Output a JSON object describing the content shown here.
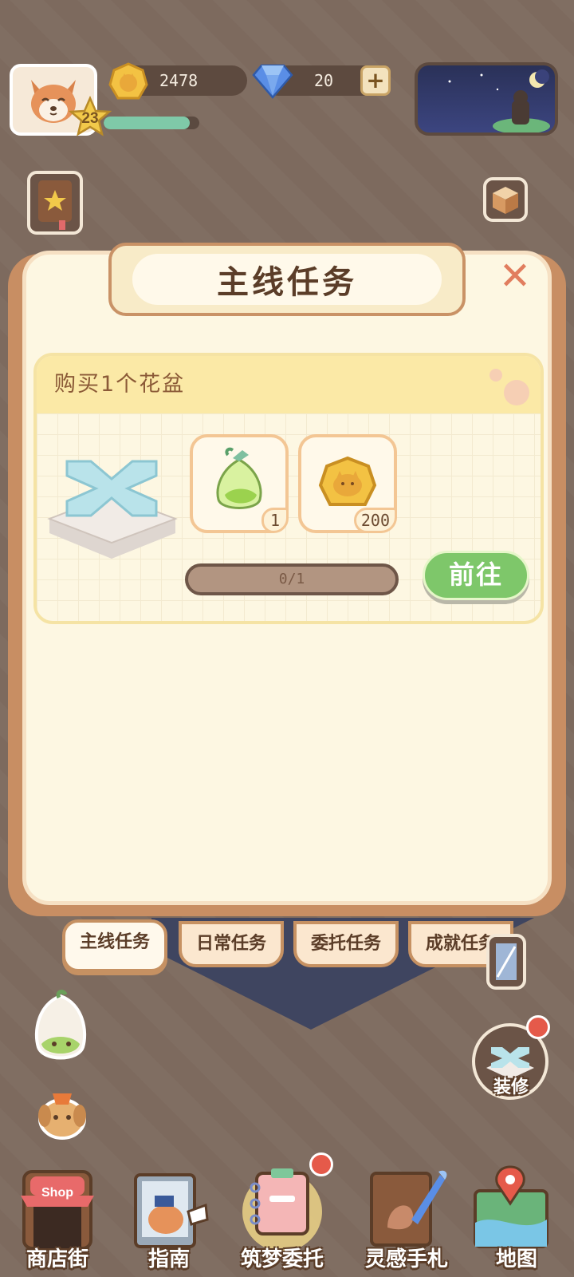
{
  "header": {
    "level": "23",
    "xp_fraction": 0.9,
    "coins": "2478",
    "gems": "20",
    "plus_label": "+"
  },
  "modal": {
    "title": "主线任务",
    "close_label": "✕"
  },
  "quest": {
    "title": "购买1个花盆",
    "rewards": [
      {
        "icon": "seed-bag-icon",
        "count": "1"
      },
      {
        "icon": "coin-icon",
        "count": "200"
      }
    ],
    "progress_text": "0/1",
    "progress_fraction": 0,
    "go_label": "前往"
  },
  "tabs": [
    {
      "label": "主线任务",
      "active": true
    },
    {
      "label": "日常任务",
      "active": false
    },
    {
      "label": "委托任务",
      "active": false
    },
    {
      "label": "成就任务",
      "active": false
    }
  ],
  "side": {
    "decorate_label": "装修"
  },
  "nav": [
    {
      "label": "商店街",
      "icon": "shop-icon",
      "sign": "Shop"
    },
    {
      "label": "指南",
      "icon": "guide-icon"
    },
    {
      "label": "筑梦委托",
      "icon": "notebook-icon"
    },
    {
      "label": "灵感手札",
      "icon": "journal-icon"
    },
    {
      "label": "地图",
      "icon": "map-icon"
    }
  ],
  "colors": {
    "background": "#7d6a5e",
    "modal": "#fdf7e2",
    "accent_green": "#7ec76a",
    "close_red": "#e17d5e"
  }
}
